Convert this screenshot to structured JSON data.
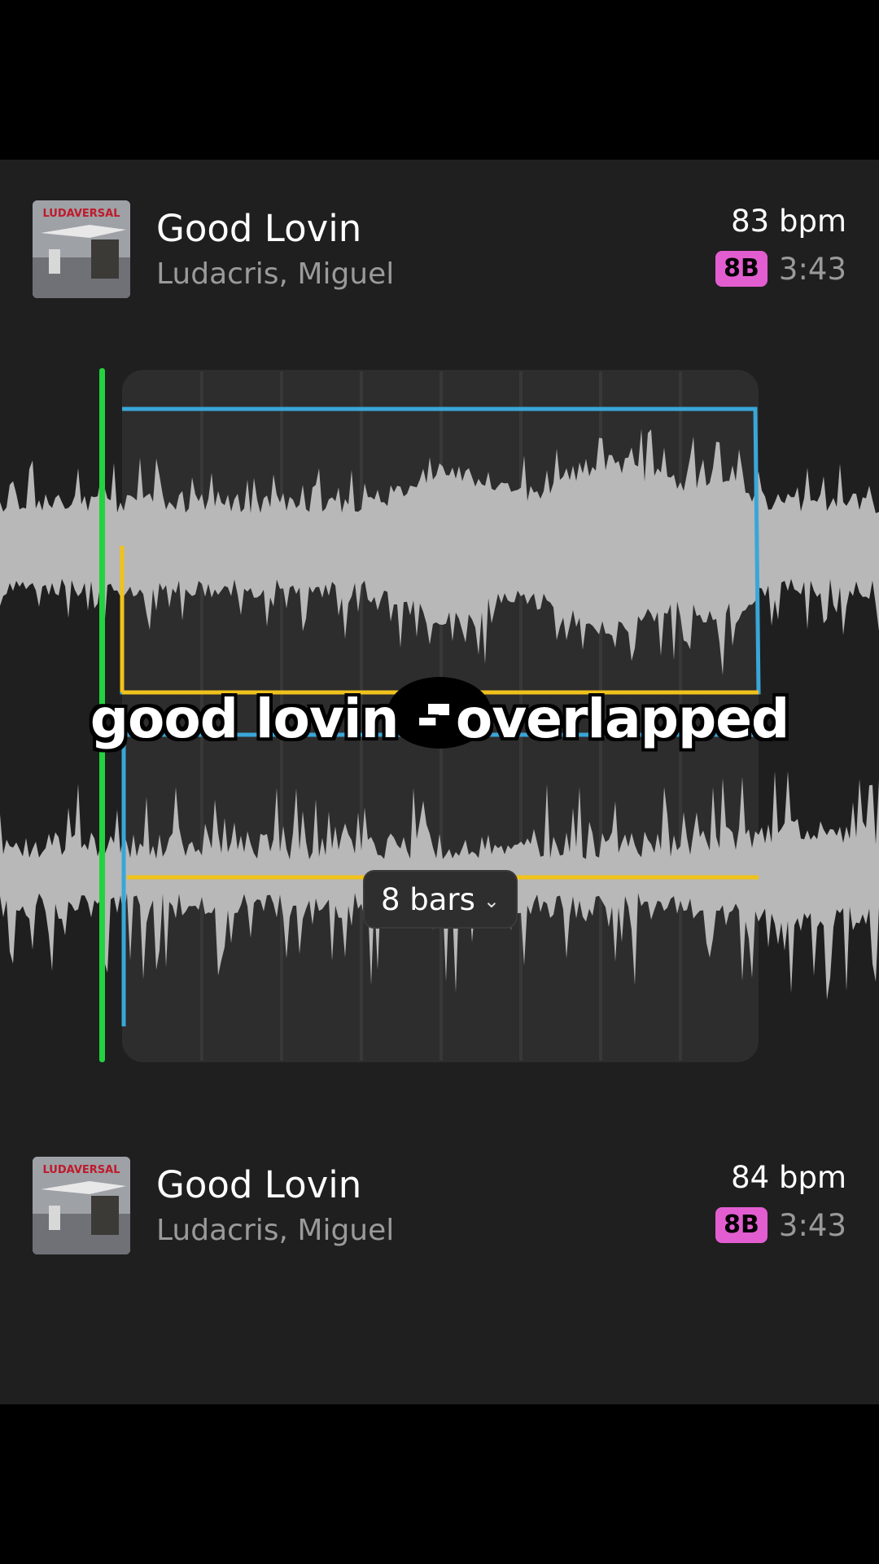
{
  "track_top": {
    "title": "Good Lovin",
    "artist": "Ludacris, Miguel",
    "bpm": "83 bpm",
    "key": "8B",
    "duration": "3:43",
    "album_art": "LUDAVERSAL"
  },
  "track_bottom": {
    "title": "Good Lovin",
    "artist": "Ludacris, Miguel",
    "bpm": "84 bpm",
    "key": "8B",
    "duration": "3:43",
    "album_art": "LUDAVERSAL"
  },
  "loop_length": {
    "label": "8 bars",
    "icon": "chevron-down-icon"
  },
  "caption": "good lovin - overlapped",
  "colors": {
    "background": "#1f1f1f",
    "playhead": "#22d33f",
    "selection_blue": "#3aa6d8",
    "selection_yellow": "#f1c21b",
    "key_badge": "#e25ed0",
    "waveform": "#b8b8b8"
  }
}
